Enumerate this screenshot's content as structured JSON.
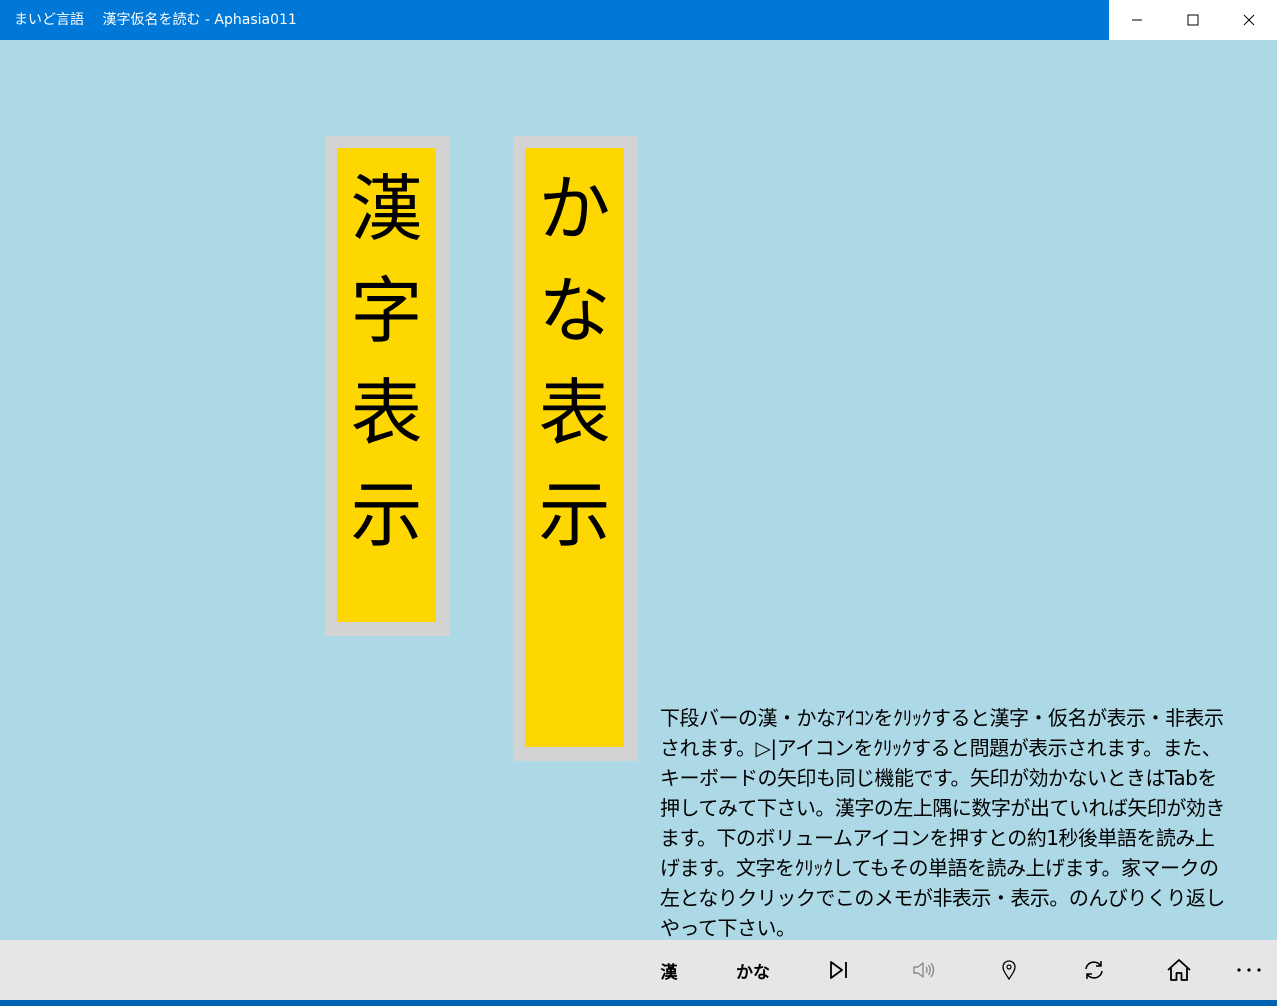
{
  "window": {
    "title": "まいど言語　 漢字仮名を読む - Aphasia011",
    "controls": {
      "minimize_icon": "minimize-icon",
      "maximize_icon": "maximize-icon",
      "close_icon": "close-icon"
    }
  },
  "cards": {
    "kanji": {
      "chars": [
        "漢",
        "字",
        "表",
        "示"
      ]
    },
    "kana": {
      "chars": [
        "か",
        "な",
        "表",
        "示"
      ]
    }
  },
  "memo": {
    "text": "下段バーの漢・かなｱｲｺﾝをｸﾘｯｸすると漢字・仮名が表示・非表示されます。▷|アイコンをｸﾘｯｸすると問題が表示されます。また、キーボードの矢印も同じ機能です。矢印が効かないときはTabを押してみて下さい。漢字の左上隅に数字が出ていれば矢印が効きます。下のボリュームアイコンを押すとの約1秒後単語を読み上げます。文字をｸﾘｯｸしてもその単語を読み上げます。家マークの左となりクリックでこのメモが非表示・表示。のんびりくり返しやって下さい。"
  },
  "appbar": {
    "kanji_label": "漢",
    "kana_label": "かな",
    "icons": [
      "next-icon",
      "volume-icon",
      "map-pin-icon",
      "refresh-icon",
      "home-icon",
      "more-icon"
    ]
  },
  "colors": {
    "background": "#ADD8E6",
    "titlebar": "#0078D7",
    "card_border": "#D3D3D3",
    "card_fill": "#FFD700",
    "appbar": "#E6E6E6"
  }
}
